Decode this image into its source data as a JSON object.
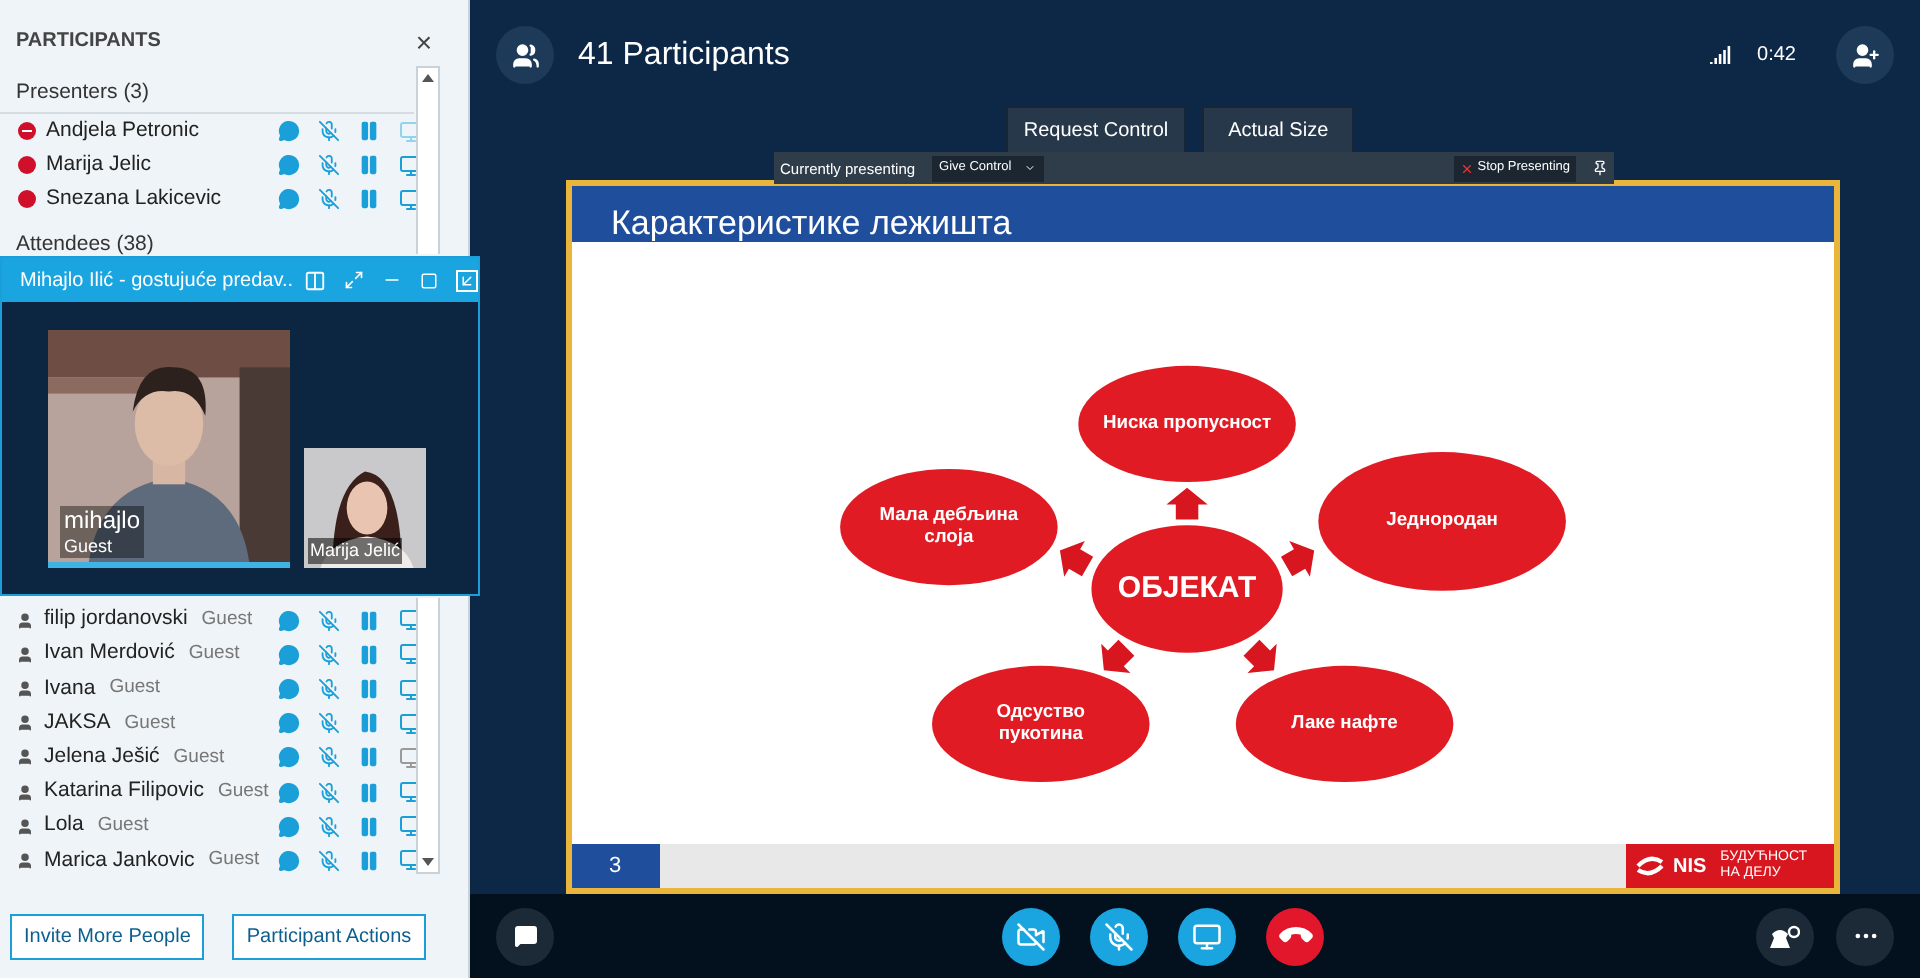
{
  "sidebar": {
    "title": "PARTICIPANTS",
    "close": "×",
    "groups": [
      {
        "label": "Presenters (3)",
        "participants": [
          {
            "name": "Andjela Petronic",
            "do_not_disturb": true,
            "presenting": true
          },
          {
            "name": "Marija Jelic",
            "do_not_disturb": false,
            "presenting": false
          },
          {
            "name": "Snezana Lakicevic",
            "do_not_disturb": false,
            "presenting": false
          }
        ]
      },
      {
        "label": "Attendees (38)",
        "participants": [
          {
            "name": "filip jordanovski",
            "role": "Guest",
            "screen_disabled": false
          },
          {
            "name": "Ivan Merdović",
            "role": "Guest",
            "screen_disabled": false
          },
          {
            "name": "Ivana",
            "role": "Guest",
            "screen_disabled": false
          },
          {
            "name": "JAKSA",
            "role": "Guest",
            "screen_disabled": false
          },
          {
            "name": "Jelena Ješić",
            "role": "Guest",
            "screen_disabled": true
          },
          {
            "name": "Katarina Filipovic",
            "role": "Guest",
            "screen_disabled": false
          },
          {
            "name": "Lola",
            "role": "Guest",
            "screen_disabled": false
          },
          {
            "name": "Marica Jankovic",
            "role": "Guest",
            "screen_disabled": false
          }
        ]
      }
    ],
    "buttons": [
      "Invite More People",
      "Participant Actions"
    ]
  },
  "video_window": {
    "title": "Mihajlo Ilić - gostujuće predav..",
    "main": {
      "name": "mihajlo",
      "role": "Guest"
    },
    "thumbnail": {
      "name": "Marija Jelić"
    }
  },
  "top_bar": {
    "title": "41 Participants",
    "time": "0:42"
  },
  "stage_buttons": [
    "Request Control",
    "Actual Size"
  ],
  "presenting_toolbar": {
    "label": "Currently presenting",
    "give_control": "Give Control",
    "stop": "Stop Presenting"
  },
  "slide": {
    "title": "Карактеристике лежишта",
    "nodes": [
      {
        "label": "ОБЈЕКАТ",
        "kind": "center"
      },
      {
        "label": "Ниска пропусност",
        "kind": "outer"
      },
      {
        "label": "Једнородан",
        "kind": "outer"
      },
      {
        "label": "Лаке нафте",
        "kind": "outer"
      },
      {
        "label": "Одсуство пукотина",
        "kind": "outer"
      },
      {
        "label": "Мала дебљина слоја",
        "kind": "outer"
      }
    ],
    "page": "3",
    "logo_text": "NIS",
    "tagline": [
      "БУДУЋНОСТ",
      "НА ДЕЛУ"
    ]
  },
  "call_controls": [
    {
      "kind": "video",
      "muted": true
    },
    {
      "kind": "mic",
      "muted": true
    },
    {
      "kind": "screen",
      "muted": false
    },
    {
      "kind": "hangup",
      "muted": false
    }
  ]
}
